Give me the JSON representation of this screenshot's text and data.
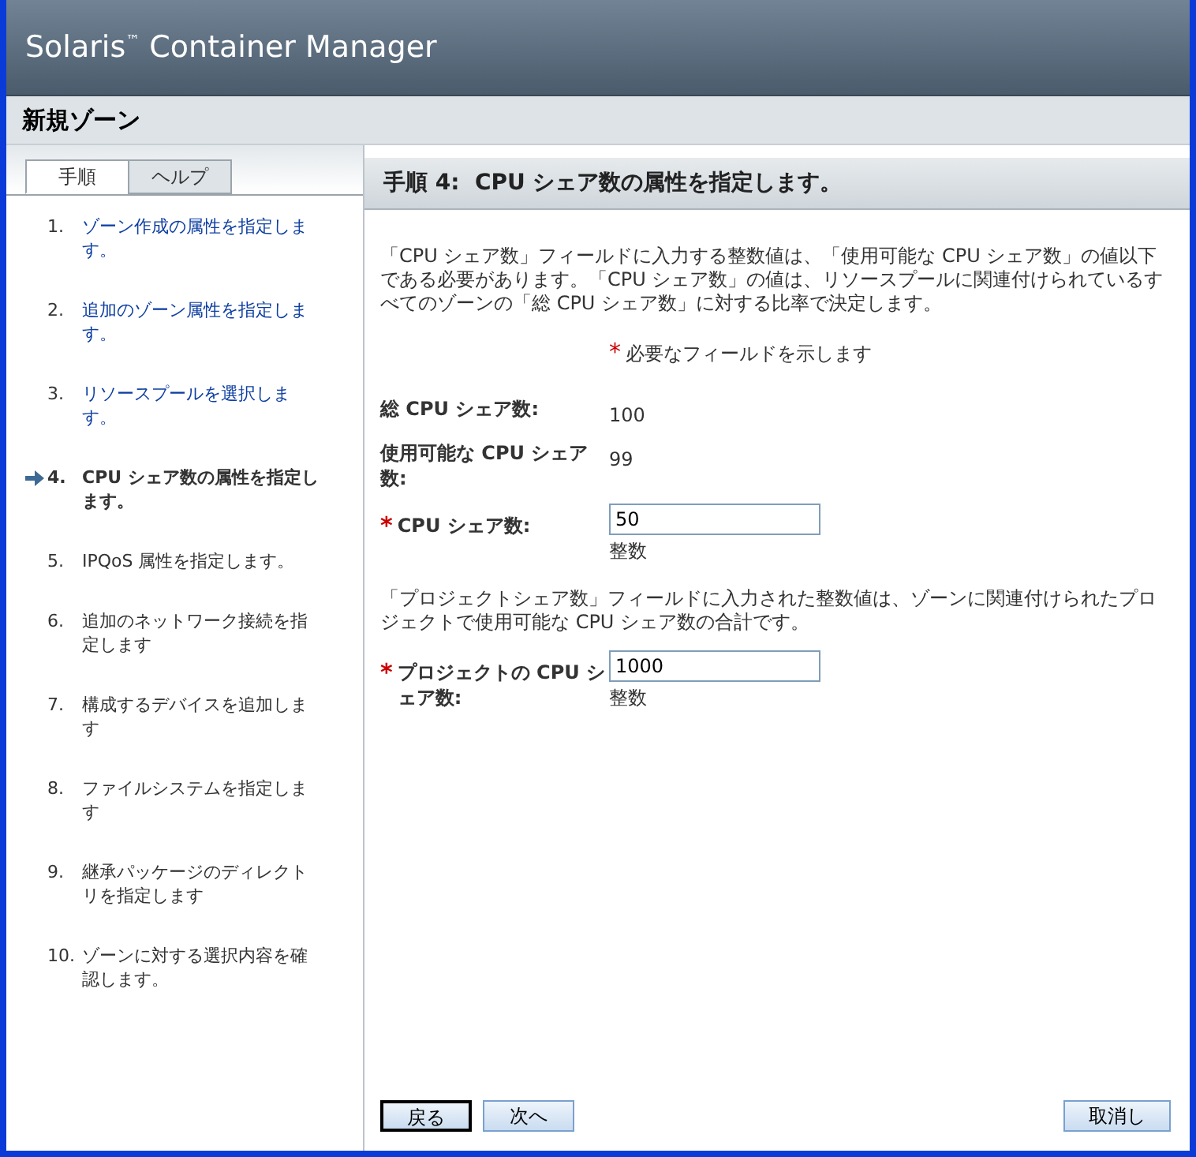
{
  "app": {
    "title": "Solaris",
    "trademark": "™",
    "title_rest": " Container Manager"
  },
  "page": {
    "title": "新規ゾーン"
  },
  "tabs": [
    {
      "label": "手順",
      "selected": true
    },
    {
      "label": "ヘルプ",
      "selected": false
    }
  ],
  "steps": [
    {
      "number": "1.",
      "label": "ゾーン作成の属性を指定します。",
      "visited": true,
      "selected": false
    },
    {
      "number": "2.",
      "label": "追加のゾーン属性を指定します。",
      "visited": true,
      "selected": false
    },
    {
      "number": "3.",
      "label": "リソースプールを選択します。",
      "visited": true,
      "selected": false
    },
    {
      "number": "4.",
      "label": "CPU シェア数の属性を指定します。",
      "visited": false,
      "selected": true
    },
    {
      "number": "5.",
      "label": "IPQoS 属性を指定します。",
      "visited": false,
      "selected": false
    },
    {
      "number": "6.",
      "label": "追加のネットワーク接続を指定します",
      "visited": false,
      "selected": false
    },
    {
      "number": "7.",
      "label": "構成するデバイスを追加します",
      "visited": false,
      "selected": false
    },
    {
      "number": "8.",
      "label": "ファイルシステムを指定します",
      "visited": false,
      "selected": false
    },
    {
      "number": "9.",
      "label": "継承パッケージのディレクトリを指定します",
      "visited": false,
      "selected": false
    },
    {
      "number": "10.",
      "label": "ゾーンに対する選択内容を確認します。",
      "visited": false,
      "selected": false
    }
  ],
  "content": {
    "heading": "手順 4:  CPU シェア数の属性を指定します。",
    "intro": "「CPU シェア数」フィールドに入力する整数値は、「使用可能な CPU シェア数」の値以下である必要があります。「CPU シェア数」の値は、リソースプールに関連付けられているすべてのゾーンの「総 CPU シェア数」に対する比率で決定します。",
    "required_mark": "*",
    "required_note": "必要なフィールドを示します",
    "fields": [
      {
        "kind": "readonly",
        "label": "総 CPU シェア数:",
        "value": "100"
      },
      {
        "kind": "readonly",
        "label": "使用可能な CPU シェア数:",
        "value": "99"
      },
      {
        "kind": "input",
        "required": true,
        "label": "CPU シェア数:",
        "value": "50",
        "hint": "整数"
      },
      {
        "kind": "note",
        "text": "「プロジェクトシェア数」フィールドに入力された整数値は、ゾーンに関連付けられたプロジェクトで使用可能な CPU シェア数の合計です。"
      },
      {
        "kind": "input",
        "required": true,
        "label": "プロジェクトの CPU シェア数:",
        "value": "1000",
        "hint": "整数"
      }
    ]
  },
  "buttons": {
    "back": "戻る",
    "next": "次へ",
    "cancel": "取消し"
  }
}
